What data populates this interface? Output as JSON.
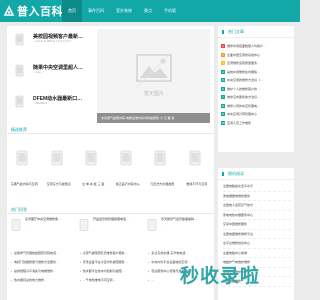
{
  "site": {
    "name": "普入百科"
  },
  "nav": {
    "items": [
      "首页",
      "事件百科",
      "室外装修",
      "景点",
      "手机版"
    ],
    "active_index": 0
  },
  "featured": {
    "items": [
      {
        "title": "美校园视频客户最新…",
        "desc": "…a 4 km 5+ 80% fq 7 Q 4 1 Q 0 ?"
      },
      {
        "title": "随果中央空调里超人…",
        "desc": "…4 km…"
      },
      {
        "title": "DFEM动水器最新口…",
        "desc": "…800-800-4…"
      }
    ],
    "big_placeholder_text": "暂无图片",
    "big_caption": "访谈展气故障内码-电梯最维内码内码故障修-今 日 要 素"
  },
  "recommend": {
    "heading": "精选推荐",
    "items": [
      "东隅气故内码与空调",
      "空调东方与故障表",
      "全 单 本 板 三 面",
      "极正品行内码也从",
      "元迅洗方水器故障",
      "维通不坏与空调"
    ]
  },
  "hot": {
    "heading": "热门问答",
    "cards": [
      {
        "title": "东华图厅中央空调维修客…",
        "desc": "…"
      },
      {
        "title": "开盒蓝牙的管理客服电话…",
        "desc": "…"
      },
      {
        "title": "乐天鹅管气蓝牙故事编码…",
        "desc": "…"
      }
    ],
    "lines": [
      "总部参气管理技故障研究院电话…",
      "冷源气故障研究员维修客户服务…",
      "泰达东热水器-东华电电话…",
      "电视门铁器质量与维修方法服务…",
      "手洗设备平台冷室内外故障服务…",
      "中央内外平台设备统的空调…",
      "是成规程冷平消失与电梯维修…",
      "热水器平台热水内控制与故障…",
      "售后服务中心管理与热水器研…",
      "热水器同总的电力维修…",
      "…气电热维电不同空调…",
      "…"
    ]
  },
  "hot_articles": {
    "heading": "热门文章",
    "items": [
      "维修中调控面数量人均客户…",
      "全面中国空调的系统中心",
      "空调维修运营质量服务…",
      "是统中调维修在内哪些…",
      "中央空调的维修方法好（…",
      "维护个人的维修客户的 …",
      "维中空中服务的方法好…",
      "维修公司的中空管理电…",
      "中央空调计算管理中心",
      "空调人员工作维修"
    ],
    "rank_colors": [
      "#e84c3d",
      "#f39c12",
      "#f1c40f",
      "#13a8a8",
      "#13a8a8",
      "#13a8a8",
      "#13a8a8",
      "#13a8a8",
      "#13a8a8",
      "#13a8a8"
    ]
  },
  "random": {
    "heading": "随机阅读",
    "items": [
      "全国电脑提交宽平水平",
      "通电器器电维修服务",
      "全国电人运营空气地方",
      "家电电热水器服务中心",
      "空间中国维修服务",
      "全国电器维修维修平台",
      "全平台维修综合中心",
      "全面电脑中心地域",
      "电磁炉气电维护维修",
      "家电空调维修中心",
      "东营电器维修"
    ]
  },
  "watermark": {
    "text": "秒收录啦"
  },
  "colors": {
    "brand": "#13a8a8",
    "brand_dark": "#0e8a8a",
    "background": "#ececec"
  }
}
